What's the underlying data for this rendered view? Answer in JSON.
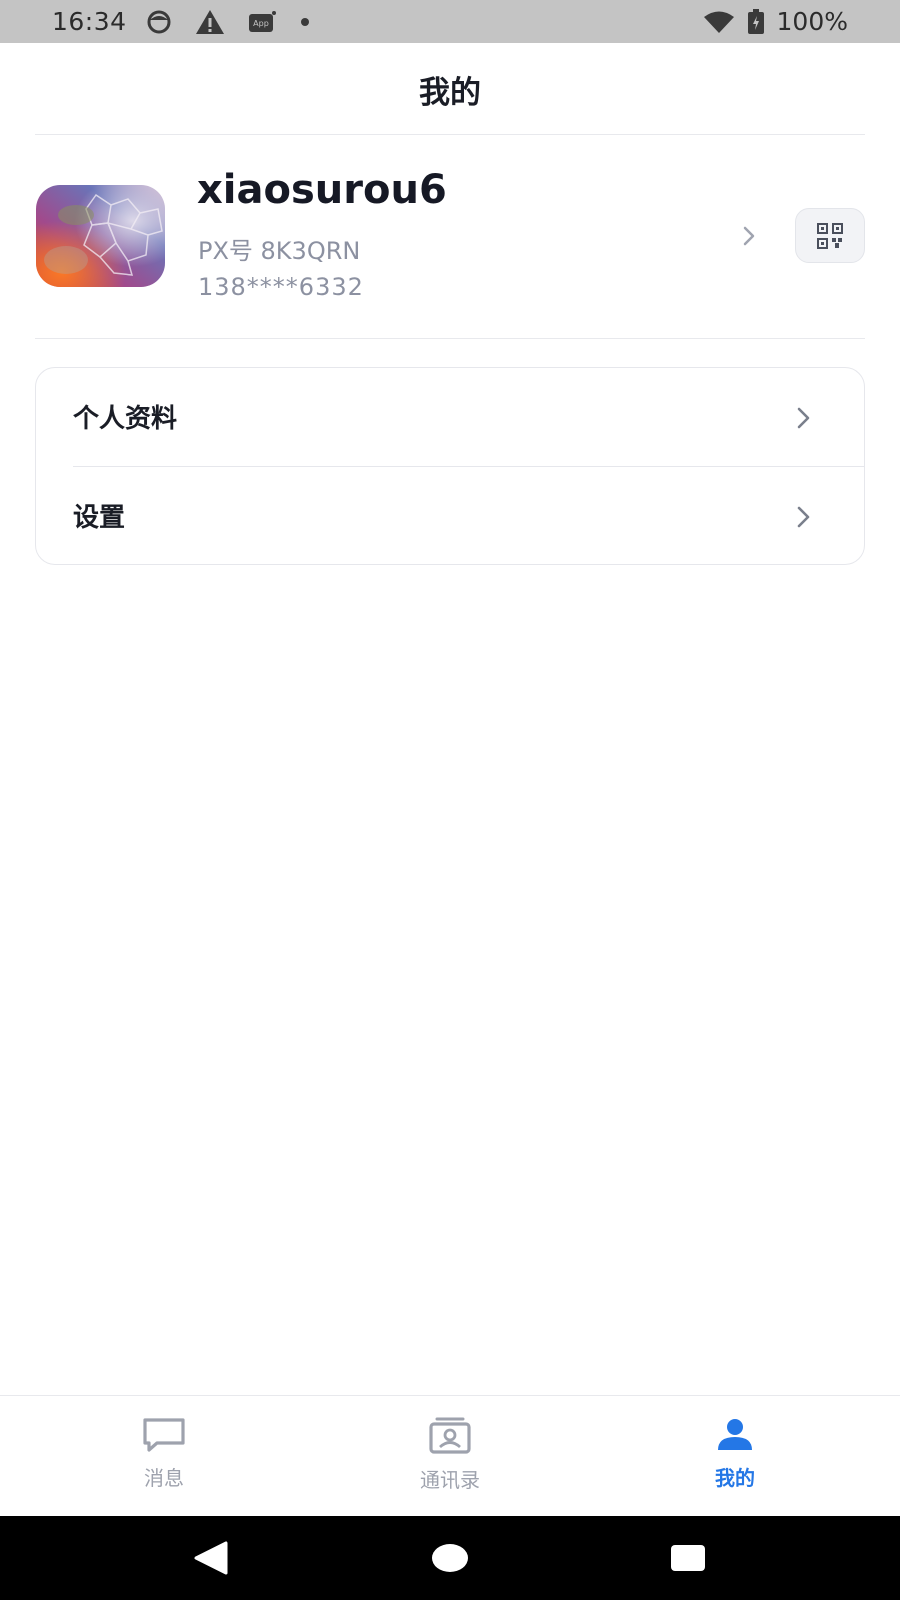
{
  "status_bar": {
    "time": "16:34",
    "battery_percent": "100%",
    "icons": [
      "face-icon",
      "warning-icon",
      "app-icon",
      "dot-icon",
      "wifi-icon",
      "battery-icon"
    ]
  },
  "header": {
    "title": "我的"
  },
  "profile": {
    "username": "xiaosurou6",
    "px_id": "PX号 8K3QRN",
    "phone": "138****6332"
  },
  "menu": {
    "items": [
      {
        "label": "个人资料"
      },
      {
        "label": "设置"
      }
    ]
  },
  "tabbar": {
    "tabs": [
      {
        "label": "消息",
        "icon": "message-icon",
        "active": false
      },
      {
        "label": "通讯录",
        "icon": "contacts-icon",
        "active": false
      },
      {
        "label": "我的",
        "icon": "person-icon",
        "active": true
      }
    ]
  },
  "colors": {
    "accent": "#2477e6",
    "status_bar_bg": "#c4c4c4",
    "muted_text": "#8c91a1"
  }
}
